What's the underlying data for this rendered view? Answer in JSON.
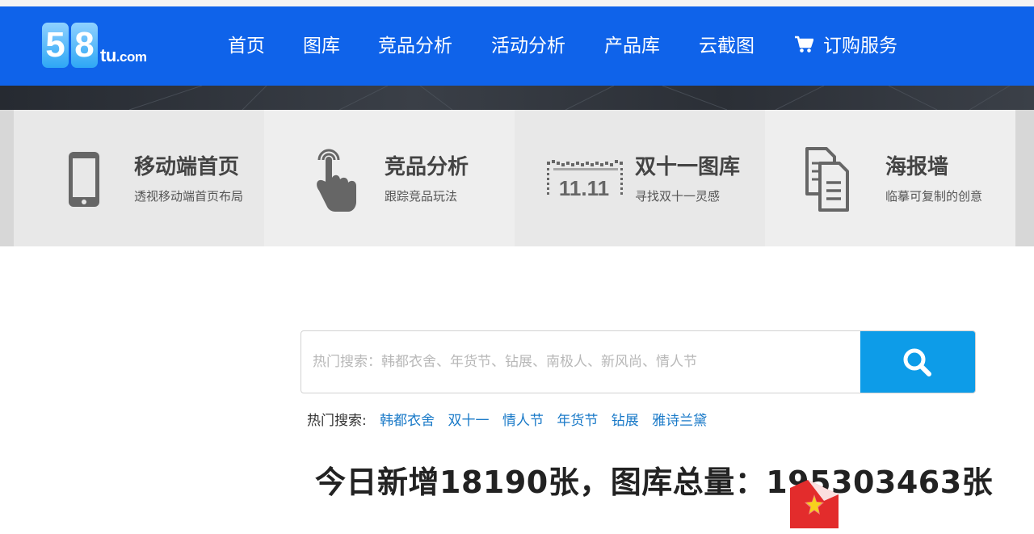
{
  "logo": {
    "digit1": "5",
    "digit2": "8",
    "text": "tu",
    "suffix": ".com"
  },
  "nav": {
    "items": [
      {
        "label": "首页"
      },
      {
        "label": "图库"
      },
      {
        "label": "竞品分析"
      },
      {
        "label": "活动分析"
      },
      {
        "label": "产品库"
      },
      {
        "label": "云截图"
      },
      {
        "label": "订购服务"
      }
    ],
    "cart_icon": "shopping-cart-icon",
    "bg_color": "#0f63ea"
  },
  "features": [
    {
      "title": "移动端首页",
      "subtitle": "透视移动端首页布局",
      "icon": "mobile-phone-icon"
    },
    {
      "title": "竞品分析",
      "subtitle": "跟踪竞品玩法",
      "icon": "touch-hand-icon"
    },
    {
      "title": "双十一图库",
      "subtitle": "寻找双十一灵感",
      "icon": "double-eleven-icon"
    },
    {
      "title": "海报墙",
      "subtitle": "临摹可复制的创意",
      "icon": "documents-icon"
    }
  ],
  "double11_text": "11.11",
  "search": {
    "placeholder": "热门搜索：韩都衣舍、年货节、钻展、南极人、新风尚、情人节",
    "button_icon": "search-icon",
    "button_color": "#0d9ce8"
  },
  "hot": {
    "label": "热门搜索:",
    "links": [
      "韩都衣舍",
      "双十一",
      "情人节",
      "年货节",
      "钻展",
      "雅诗兰黛"
    ],
    "link_color": "#1a7ac8"
  },
  "stats": {
    "text": "今日新增18190张，图库总量：195303463张"
  }
}
